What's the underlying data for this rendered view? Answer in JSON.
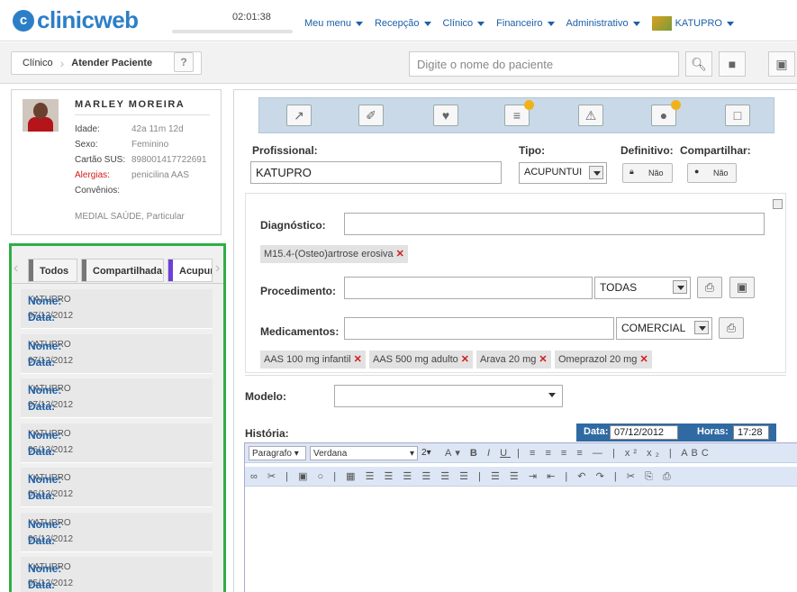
{
  "app": {
    "logo_text": "clinicweb",
    "clock": "02:01:38",
    "nav": [
      "Meu menu",
      "Recepção",
      "Clínico",
      "Financeiro",
      "Administrativo"
    ],
    "user": "KATUPRO"
  },
  "breadcrumb": {
    "root": "Clínico",
    "current": "Atender Paciente"
  },
  "search": {
    "placeholder": "Digite o nome do paciente"
  },
  "patient": {
    "name": "MARLEY MOREIRA",
    "rows": [
      {
        "key": "Idade:",
        "value": "42a 11m 12d"
      },
      {
        "key": "Sexo:",
        "value": "Feminino"
      },
      {
        "key": "Cartão SUS:",
        "value": "898001417722691"
      },
      {
        "key": "Alergias:",
        "value": "penicilina AAS"
      },
      {
        "key": "Convênios:",
        "value": ""
      }
    ],
    "convenios_value": "MEDIAL SAÚDE, Particular"
  },
  "history": {
    "tabs": [
      "Todos",
      "Compartilhada",
      "Acupuntura"
    ],
    "accent": "#2fae45",
    "name_label": "Nome:",
    "date_label": "Data:",
    "items": [
      {
        "name": "KATUPRO",
        "date": "07/12/2012"
      },
      {
        "name": "KATUPRO",
        "date": "07/12/2012"
      },
      {
        "name": "KATUPRO",
        "date": "07/12/2012"
      },
      {
        "name": "KATUPRO",
        "date": "06/12/2012"
      },
      {
        "name": "KATUPRO",
        "date": "06/12/2012"
      },
      {
        "name": "KATUPRO",
        "date": "06/12/2012"
      },
      {
        "name": "KATUPRO",
        "date": "05/12/2012"
      }
    ]
  },
  "form": {
    "profissional_label": "Profissional:",
    "profissional_value": "KATUPRO",
    "tipo_label": "Tipo:",
    "tipo_value": "ACUPUNTUI",
    "definitivo_label": "Definitivo:",
    "definitivo_value": "Não",
    "compartilhar_label": "Compartilhar:",
    "compartilhar_value": "Não",
    "diagnostico_label": "Diagnóstico:",
    "diagnostico_tag": "M15.4-(Osteo)artrose erosiva",
    "procedimento_label": "Procedimento:",
    "procedimento_filter": "TODAS",
    "medicamentos_label": "Medicamentos:",
    "medicamentos_filter": "COMERCIAL",
    "medicamentos_tags": [
      "AAS 100 mg infantil",
      "AAS 500 mg adulto",
      "Arava 20 mg",
      "Omeprazol 20 mg"
    ],
    "modelo_label": "Modelo:",
    "historia_label": "História:",
    "data_label": "Data:",
    "data_value": "07/12/2012",
    "horas_label": "Horas:",
    "horas_value": "17:28"
  },
  "editor": {
    "format": "Paragrafo",
    "font": "Verdana",
    "size": "2"
  }
}
